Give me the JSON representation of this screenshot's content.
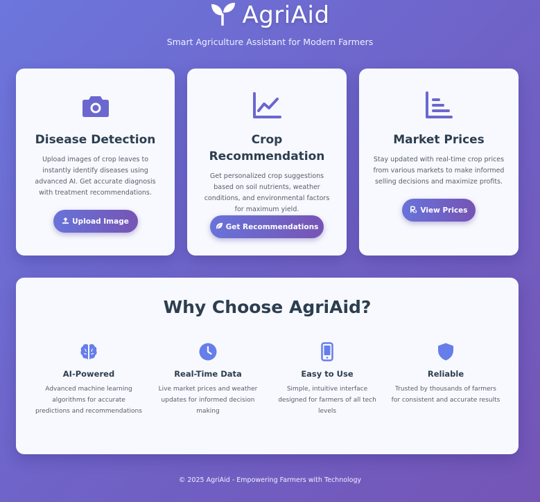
{
  "header": {
    "brand_icon": "seedling-icon",
    "title": "AgriAid",
    "tagline": "Smart Agriculture Assistant for Modern Farmers"
  },
  "cards": [
    {
      "icon": "camera-icon",
      "title": "Disease Detection",
      "description": "Upload images of crop leaves to instantly identify diseases using advanced AI. Get accurate diagnosis with treatment recommendations.",
      "button_icon": "upload-icon",
      "button_label": "Upload Image"
    },
    {
      "icon": "line-chart-icon",
      "title": "Crop Recommendation",
      "description": "Get personalized crop suggestions based on soil nutrients, weather conditions, and environmental factors for maximum yield.",
      "button_icon": "leaf-icon",
      "button_label": "Get Recommendations"
    },
    {
      "icon": "bar-chart-icon",
      "title": "Market Prices",
      "description": "Stay updated with real-time crop prices from various markets to make informed selling decisions and maximize profits.",
      "button_icon": "rupee-icon",
      "button_label": "View Prices"
    }
  ],
  "why": {
    "title": "Why Choose AgriAid?",
    "features": [
      {
        "icon": "brain-icon",
        "title": "AI-Powered",
        "description": "Advanced machine learning algorithms for accurate predictions and recommendations"
      },
      {
        "icon": "clock-icon",
        "title": "Real-Time Data",
        "description": "Live market prices and weather updates for informed decision making"
      },
      {
        "icon": "mobile-icon",
        "title": "Easy to Use",
        "description": "Simple, intuitive interface designed for farmers of all tech levels"
      },
      {
        "icon": "shield-icon",
        "title": "Reliable",
        "description": "Trusted by thousands of farmers for consistent and accurate results"
      }
    ]
  },
  "footer": {
    "text": "© 2025 AgriAid - Empowering Farmers with Technology"
  },
  "colors": {
    "accent": "#6b67cf",
    "heading": "#2c3e50",
    "card_bg": "#f8f9fe",
    "feature_icon": "#667eea"
  }
}
